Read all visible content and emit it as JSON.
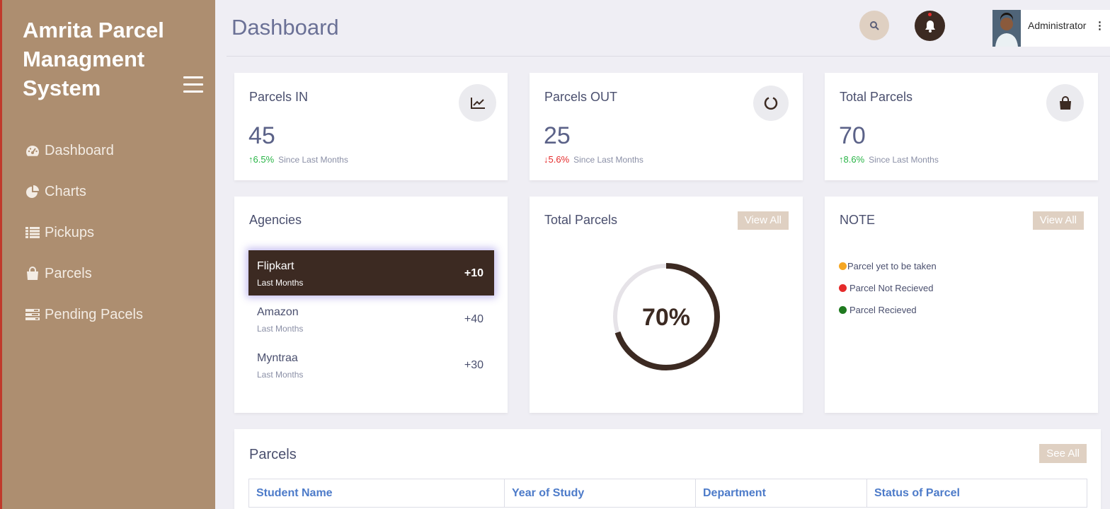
{
  "sidebar": {
    "brand": "Amrita Parcel Managment System",
    "items": [
      {
        "label": "Dashboard",
        "icon": "dashboard-icon"
      },
      {
        "label": "Charts",
        "icon": "pie-chart-icon"
      },
      {
        "label": "Pickups",
        "icon": "list-icon"
      },
      {
        "label": "Parcels",
        "icon": "shopping-bag-icon"
      },
      {
        "label": "Pending Pacels",
        "icon": "tasks-icon"
      }
    ]
  },
  "header": {
    "title": "Dashboard",
    "user_name": "Administrator",
    "kebab": "⋮"
  },
  "stats": [
    {
      "title": "Parcels IN",
      "value": "45",
      "arrow": "↑",
      "trend": "6.5%",
      "since": "Since Last Months",
      "trend_color": "#28b446",
      "icon": "line-chart-icon"
    },
    {
      "title": "Parcels OUT",
      "value": "25",
      "arrow": "↓",
      "trend": "5.6%",
      "since": "Since Last Months",
      "trend_color": "#e52b2b",
      "icon": "circle-notch-icon"
    },
    {
      "title": "Total Parcels",
      "value": "70",
      "arrow": "↑",
      "trend": "8.6%",
      "since": "Since Last Months",
      "trend_color": "#28b446",
      "icon": "shopping-bag-icon"
    }
  ],
  "agencies": {
    "title": "Agencies",
    "items": [
      {
        "name": "Flipkart",
        "sub": "Last Months",
        "count": "+10"
      },
      {
        "name": "Amazon",
        "sub": "Last Months",
        "count": "+40"
      },
      {
        "name": "Myntraa",
        "sub": "Last Months",
        "count": "+30"
      }
    ]
  },
  "total_parcels": {
    "title": "Total Parcels",
    "view_all": "View All",
    "percent_label": "70%",
    "percent": 70
  },
  "note": {
    "title": "NOTE",
    "view_all": "View All",
    "items": [
      {
        "label": "Parcel yet to be taken",
        "color": "#f5a623"
      },
      {
        "label": "Parcel Not Recieved",
        "color": "#e52b2b"
      },
      {
        "label": "Parcel Recieved",
        "color": "#1f7a1f"
      }
    ]
  },
  "parcels_table": {
    "title": "Parcels",
    "see_all": "See All",
    "columns": [
      "Student Name",
      "Year of Study",
      "Department",
      "Status of Parcel"
    ]
  },
  "colors": {
    "sidebar": "#ad8e70",
    "accent_dark": "#3c2a22",
    "button_beige": "#dfd0c2"
  }
}
